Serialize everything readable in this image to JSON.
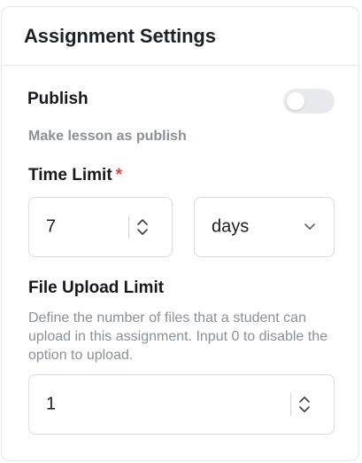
{
  "card": {
    "title": "Assignment Settings"
  },
  "publish": {
    "label": "Publish",
    "enabled": false,
    "help": "Make lesson as publish"
  },
  "time_limit": {
    "label": "Time Limit",
    "required_mark": "*",
    "value": "7",
    "unit": "days"
  },
  "file_upload_limit": {
    "label": "File Upload Limit",
    "help": "Define the number of files that a student can upload in this assignment. Input 0 to disable the option to upload.",
    "value": "1"
  },
  "icons": {
    "stepper": "up-down-chevrons-icon",
    "select": "chevron-down-icon"
  },
  "colors": {
    "required": "#e0473f",
    "toggle_off": "#e7e9ec",
    "muted_text": "#8a9099",
    "border": "#d7dbe0"
  }
}
